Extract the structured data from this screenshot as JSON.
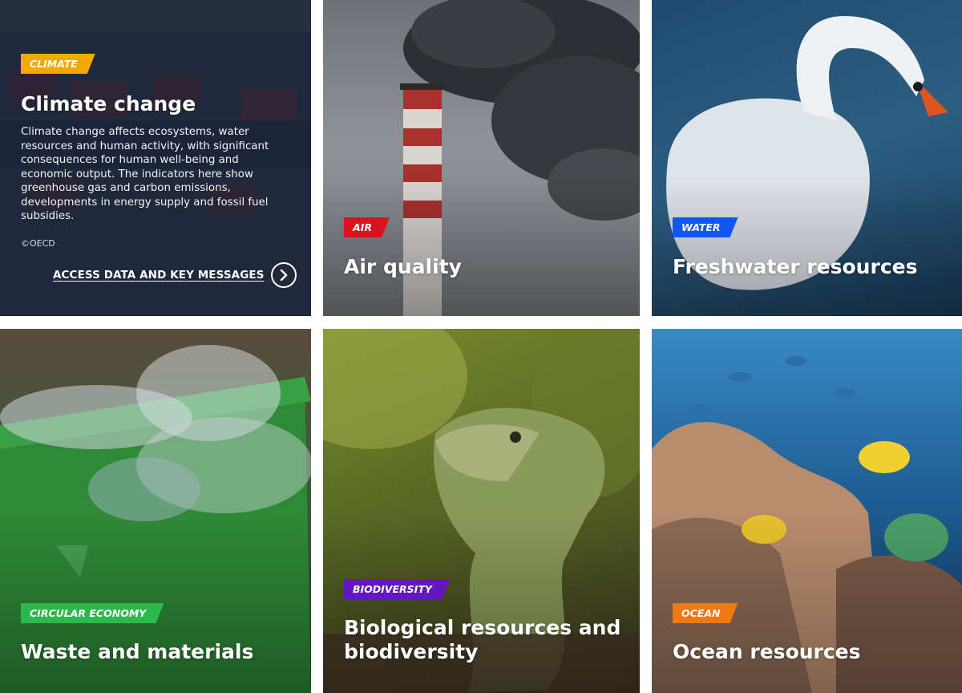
{
  "tiles": [
    {
      "tag": "CLIMATE",
      "tag_color": "#f5a800",
      "title": "Climate change",
      "description": "Climate change affects ecosystems, water resources and human activity, with significant consequences for human well-being and economic output. The indicators here show greenhouse gas and carbon emissions, developments in energy supply and fossil fuel subsidies.",
      "credit": "©OECD",
      "cta_label": "ACCESS DATA AND KEY MESSAGES",
      "cta_icon": "chevron-right-circle-icon"
    },
    {
      "tag": "AIR",
      "tag_color": "#d8141e",
      "title": "Air quality"
    },
    {
      "tag": "WATER",
      "tag_color": "#1355f0",
      "title": "Freshwater resources"
    },
    {
      "tag": "CIRCULAR ECONOMY",
      "tag_color": "#2db84b",
      "title": "Waste and materials"
    },
    {
      "tag": "BIODIVERSITY",
      "tag_color": "#6416c0",
      "title": "Biological resources and biodiversity"
    },
    {
      "tag": "OCEAN",
      "tag_color": "#f07814",
      "title": "Ocean resources"
    }
  ]
}
